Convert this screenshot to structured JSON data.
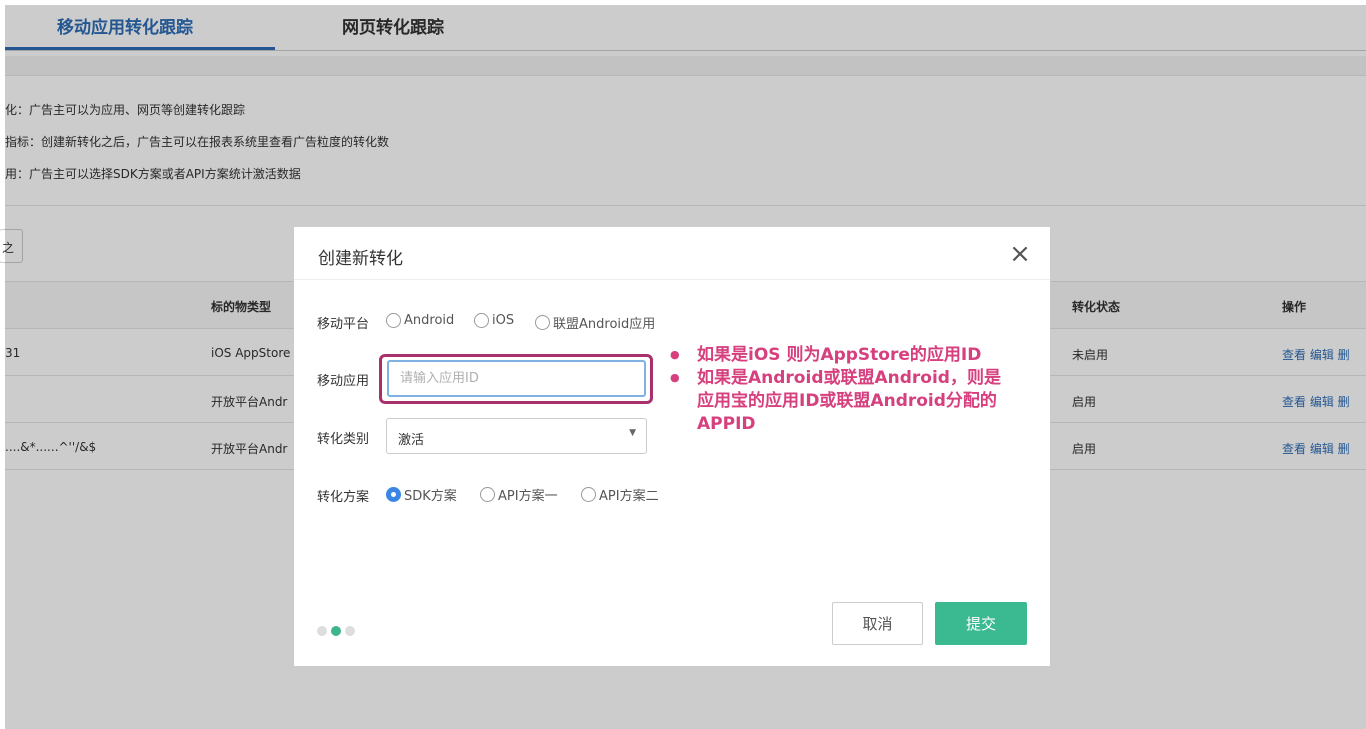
{
  "tabs": [
    {
      "label": "移动应用转化跟踪"
    },
    {
      "label": "网页转化跟踪"
    }
  ],
  "descriptions": [
    "化：广告主可以为应用、网页等创建转化跟踪",
    "指标：创建新转化之后，广告主可以在报表系统里查看广告粒度的转化数",
    "用：广告主可以选择SDK方案或者API方案统计激活数据"
  ],
  "stub_button": "之",
  "table": {
    "headers": {
      "type": "标的物类型",
      "status": "转化状态",
      "ops": "操作"
    },
    "rows": [
      {
        "id": "31",
        "type": "iOS AppStore",
        "status": "未启用",
        "ops": "查看 编辑 删"
      },
      {
        "id": "",
        "type": "开放平台Andr",
        "status": "启用",
        "ops": "查看 编辑 删"
      },
      {
        "id": "....&*......^''/&$",
        "type": "开放平台Andr",
        "status": "启用",
        "ops": "查看 编辑 删"
      }
    ]
  },
  "dialog": {
    "title": "创建新转化",
    "platform": {
      "label": "移动平台",
      "options": [
        "Android",
        "iOS",
        "联盟Android应用"
      ]
    },
    "app": {
      "label": "移动应用",
      "placeholder": "请输入应用ID",
      "value": ""
    },
    "category": {
      "label": "转化类别",
      "selected": "激活"
    },
    "plan": {
      "label": "转化方案",
      "options": [
        "SDK方案",
        "API方案一",
        "API方案二"
      ],
      "selected": "SDK方案"
    },
    "pager": {
      "total": 3,
      "active": 2
    },
    "cancel_label": "取消",
    "submit_label": "提交"
  },
  "annotation": {
    "item1": "如果是iOS 则为AppStore的应用ID",
    "item2_line1": "如果是Android或联盟Android，则是",
    "item2_line2": "应用宝的应用ID或联盟Android分配的",
    "item2_line3": "APPID"
  },
  "colors": {
    "accent_blue": "#2d6db7",
    "submit_green": "#3bba92",
    "annotation_pink": "#d6407e",
    "highlight_border": "#a8316b"
  }
}
